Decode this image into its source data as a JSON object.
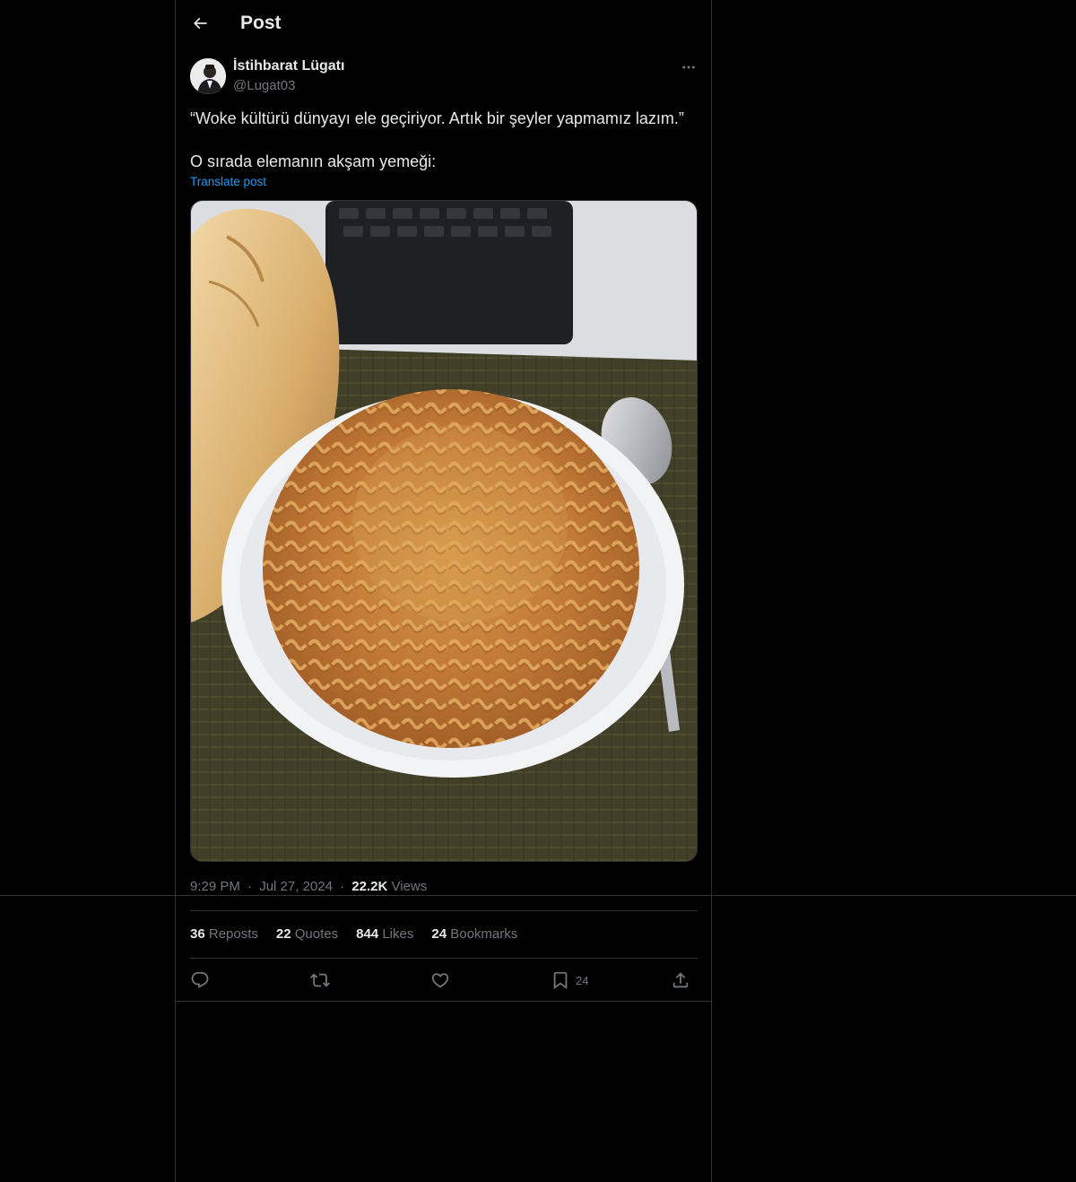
{
  "header": {
    "title": "Post"
  },
  "author": {
    "name": "İstihbarat Lügatı",
    "handle": "@Lugat03"
  },
  "tweet": {
    "line1": "“Woke kültürü dünyayı ele geçiriyor. Artık bir şeyler yapmamız lazım.”",
    "line2": "O sırada elemanın akşam yemeği:",
    "translate_label": "Translate post"
  },
  "meta": {
    "time": "9:29 PM",
    "dot1": "·",
    "date": "Jul 27, 2024",
    "dot2": "·",
    "views_count": "22.2K",
    "views_label": "Views"
  },
  "stats": {
    "reposts_count": "36",
    "reposts_label": "Reposts",
    "quotes_count": "22",
    "quotes_label": "Quotes",
    "likes_count": "844",
    "likes_label": "Likes",
    "bookmarks_count": "24",
    "bookmarks_label": "Bookmarks"
  },
  "actions": {
    "bookmark_count": "24"
  },
  "icons": {
    "back": "arrow-left-icon",
    "more": "more-horizontal-icon",
    "reply": "reply-icon",
    "repost": "repost-icon",
    "like": "heart-icon",
    "bookmark": "bookmark-icon",
    "share": "share-icon"
  },
  "colors": {
    "background": "#000000",
    "text": "#e7e9ea",
    "muted": "#71767b",
    "link": "#1d9bf0",
    "border": "#2f3336"
  }
}
